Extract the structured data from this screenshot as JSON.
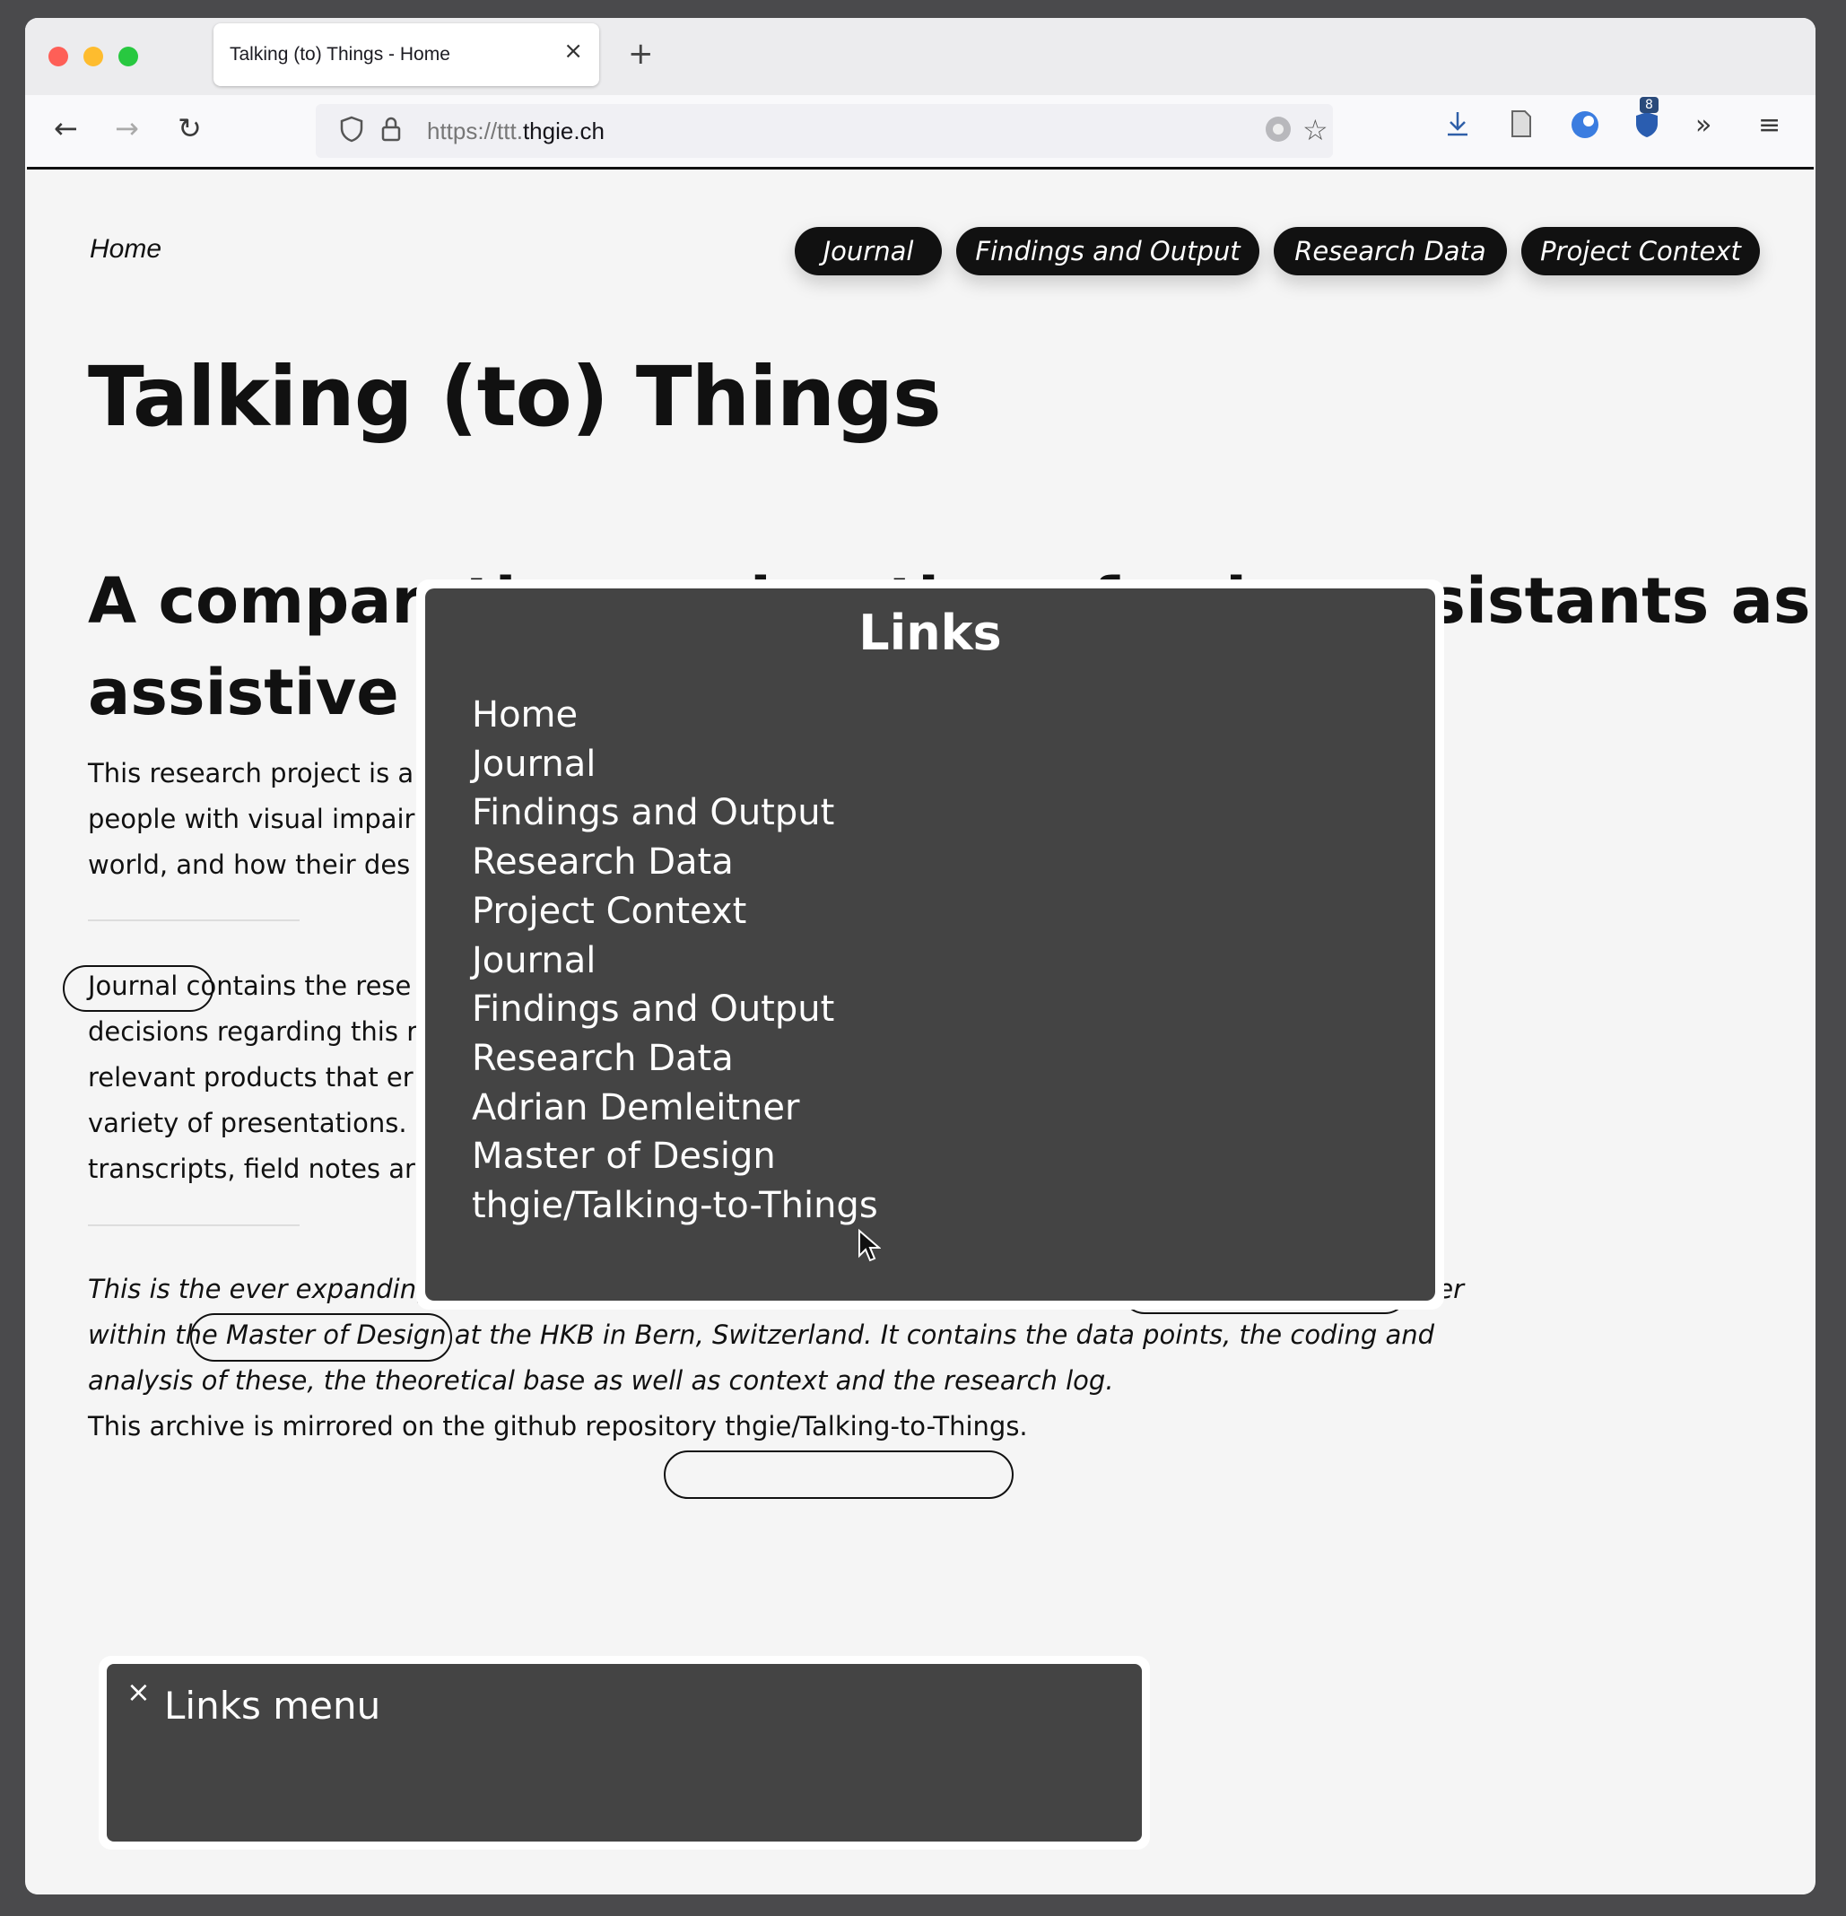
{
  "browser": {
    "tab_title": "Talking (to) Things - Home",
    "tab_close": "×",
    "new_tab": "+",
    "url_prefix": "https://ttt.",
    "url_domain": "thgie.ch",
    "extension_badge": "8",
    "back_icon": "←",
    "forward_icon": "→",
    "reload_icon": "↻",
    "overflow_icon": "»",
    "menu_icon": "≡"
  },
  "nav": {
    "breadcrumb": "Home",
    "buttons": [
      "Journal",
      "Findings and Output",
      "Research Data",
      "Project Context"
    ]
  },
  "main": {
    "title": "Talking (to) Things",
    "subtitle_line1": "A comparative exploration of voice assistants as",
    "subtitle_line2": "assistive t",
    "intro_lines": [
      "This research project is a",
      "people with visual impair",
      "world, and how their des"
    ],
    "journal_lines": [
      "Journal contains the rese",
      "decisions regarding this r",
      "relevant products that er",
      "variety of presentations.",
      "transcripts, field notes ar"
    ],
    "italic_line1": "This is the ever expanding project documentation and archive of a research project by Adrian Demleitner",
    "italic_line2": "within the Master of Design at the HKB in Bern, Switzerland. It contains the data points, the coding and",
    "italic_line3": "analysis of these, the theoretical base as well as context and the research log.",
    "mirror_line": "This archive is mirrored on the github repository thgie/Talking-to-Things."
  },
  "links_popup": {
    "heading": "Links",
    "items": [
      "Home",
      "Journal",
      "Findings and Output",
      "Research Data",
      "Project Context",
      "Journal",
      "Findings and Output",
      "Research Data",
      "Adrian Demleitner",
      "Master of Design",
      "thgie/Talking-to-Things"
    ]
  },
  "links_menu": {
    "close": "×",
    "title": "Links menu"
  }
}
